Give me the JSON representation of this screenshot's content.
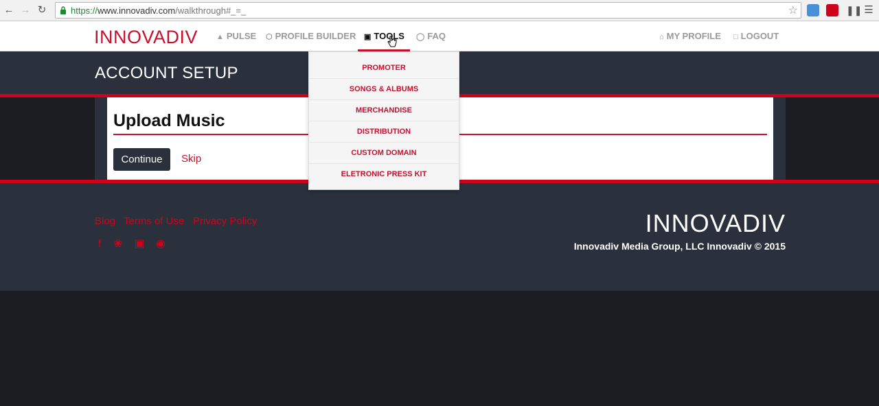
{
  "browser": {
    "url_protocol": "https://",
    "url_host": "www.innovadiv.com",
    "url_path": "/walkthrough#_=_",
    "back_icon": "back-arrow-icon",
    "forward_icon": "forward-arrow-icon",
    "reload_icon": "reload-icon"
  },
  "nav": {
    "logo": "INNOVADIV",
    "pulse": "PULSE",
    "profile_builder": "PROFILE BUILDER",
    "tools": "TOOLS",
    "faq": "FAQ",
    "my_profile": "MY PROFILE",
    "logout": "LOGOUT"
  },
  "header": {
    "title": "ACCOUNT SETUP"
  },
  "card": {
    "title": "Upload Music",
    "continue_label": "Continue",
    "skip_label": "Skip"
  },
  "dropdown": {
    "items": [
      "PROMOTER",
      "SONGS & ALBUMS",
      "MERCHANDISE",
      "DISTRIBUTION",
      "CUSTOM DOMAIN",
      "ELETRONIC PRESS KIT"
    ]
  },
  "footer": {
    "links": [
      "Blog",
      "Terms of Use",
      "Privacy Policy"
    ],
    "social_icons": [
      "facebook-icon",
      "twitter-icon",
      "instagram-icon",
      "github-icon"
    ],
    "logo": "INNOVADIV",
    "copyright": "Innovadiv Media Group, LLC Innovadiv © 2015"
  },
  "colors": {
    "accent": "#c8102e",
    "dark": "#2a313c",
    "darker": "#1b1d22"
  }
}
